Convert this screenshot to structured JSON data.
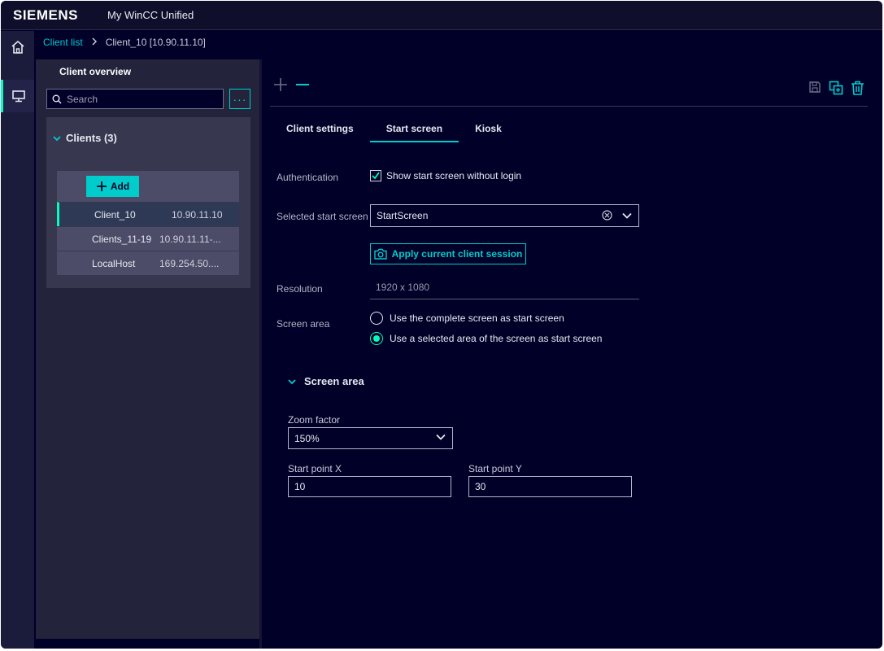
{
  "header": {
    "logo": "SIEMENS",
    "app_title": "My WinCC Unified"
  },
  "rail": {
    "items": [
      {
        "icon": "home-icon"
      },
      {
        "icon": "monitor-icon",
        "active": true
      }
    ]
  },
  "breadcrumb": {
    "root": "Client list",
    "current": "Client_10 [10.90.11.10]"
  },
  "overview": {
    "title": "Client overview",
    "search_placeholder": "Search",
    "more_label": "···",
    "clients_header": "Clients (3)",
    "add_label": "Add",
    "clients": [
      {
        "name": "Client_10",
        "ip": "10.90.11.10",
        "selected": true
      },
      {
        "name": "Clients_11-19",
        "ip": "10.90.11.11-..."
      },
      {
        "name": "LocalHost",
        "ip": "169.254.50...."
      }
    ]
  },
  "tabs": [
    {
      "label": "Client settings"
    },
    {
      "label": "Start screen",
      "active": true
    },
    {
      "label": "Kiosk"
    }
  ],
  "form": {
    "authentication_label": "Authentication",
    "show_without_login_label": "Show start screen without login",
    "show_without_login_checked": true,
    "selected_start_screen_label": "Selected start screen",
    "selected_start_screen_value": "StartScreen",
    "apply_session_label": "Apply current client session",
    "resolution_label": "Resolution",
    "resolution_value": "1920 x 1080",
    "screen_area_label": "Screen area",
    "screen_area_options": [
      {
        "label": "Use the complete screen as start screen",
        "checked": false
      },
      {
        "label": "Use a selected area of the screen as start screen",
        "checked": true
      }
    ]
  },
  "screen_area_section": {
    "title": "Screen area",
    "zoom_label": "Zoom factor",
    "zoom_value": "150%",
    "start_x_label": "Start point X",
    "start_x_value": "10",
    "start_y_label": "Start point Y",
    "start_y_value": "30"
  },
  "colors": {
    "accent": "#00cccc",
    "selection": "#00ffb9",
    "background": "#000028"
  }
}
